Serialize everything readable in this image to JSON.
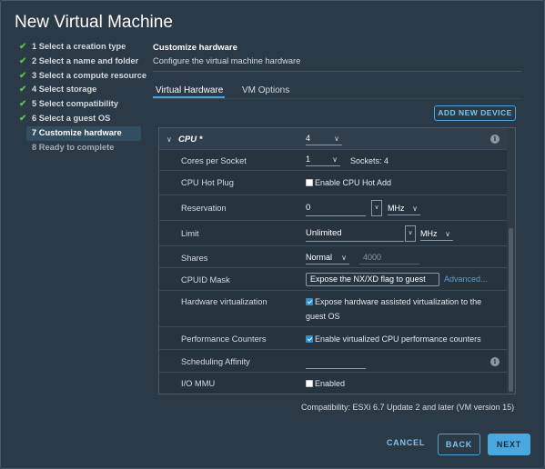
{
  "dialog": {
    "title": "New Virtual Machine"
  },
  "steps": [
    {
      "label": "1 Select a creation type",
      "state": "done"
    },
    {
      "label": "2 Select a name and folder",
      "state": "done"
    },
    {
      "label": "3 Select a compute resource",
      "state": "done"
    },
    {
      "label": "4 Select storage",
      "state": "done"
    },
    {
      "label": "5 Select compatibility",
      "state": "done"
    },
    {
      "label": "6 Select a guest OS",
      "state": "done"
    },
    {
      "label": "7 Customize hardware",
      "state": "active"
    },
    {
      "label": "8 Ready to complete",
      "state": "todo"
    }
  ],
  "section": {
    "title": "Customize hardware",
    "subtitle": "Configure the virtual machine hardware"
  },
  "tabs": [
    {
      "label": "Virtual Hardware",
      "active": true
    },
    {
      "label": "VM Options",
      "active": false
    }
  ],
  "add_device_label": "ADD NEW DEVICE",
  "cpu": {
    "label": "CPU *",
    "count": "4",
    "cores_per_socket": {
      "label": "Cores per Socket",
      "value": "1",
      "sockets_text": "Sockets: 4"
    },
    "hot_plug": {
      "label": "CPU Hot Plug",
      "checkbox_label": "Enable CPU Hot Add",
      "checked": false
    },
    "reservation": {
      "label": "Reservation",
      "value": "0",
      "unit": "MHz"
    },
    "limit": {
      "label": "Limit",
      "value": "Unlimited",
      "unit": "MHz"
    },
    "shares": {
      "label": "Shares",
      "level": "Normal",
      "value": "4000"
    },
    "cpuid_mask": {
      "label": "CPUID Mask",
      "value": "Expose the NX/XD flag to guest",
      "link": "Advanced..."
    },
    "hw_virtualization": {
      "label": "Hardware virtualization",
      "checkbox_label_line1": "Expose hardware assisted virtualization to the",
      "checkbox_label_line2": "guest OS",
      "checked": true
    },
    "perf_counters": {
      "label": "Performance Counters",
      "checkbox_label": "Enable virtualized CPU performance counters",
      "checked": true
    },
    "sched_affinity": {
      "label": "Scheduling Affinity",
      "value": ""
    },
    "iommu": {
      "label": "I/O MMU",
      "checkbox_label": "Enabled",
      "checked": false
    }
  },
  "compatibility_text": "Compatibility: ESXi 6.7 Update 2 and later (VM version 15)",
  "footer": {
    "cancel": "CANCEL",
    "back": "BACK",
    "next": "NEXT"
  },
  "colors": {
    "accent": "#49a8dd",
    "check": "#5bbf40",
    "bg": "#2a3a46"
  }
}
